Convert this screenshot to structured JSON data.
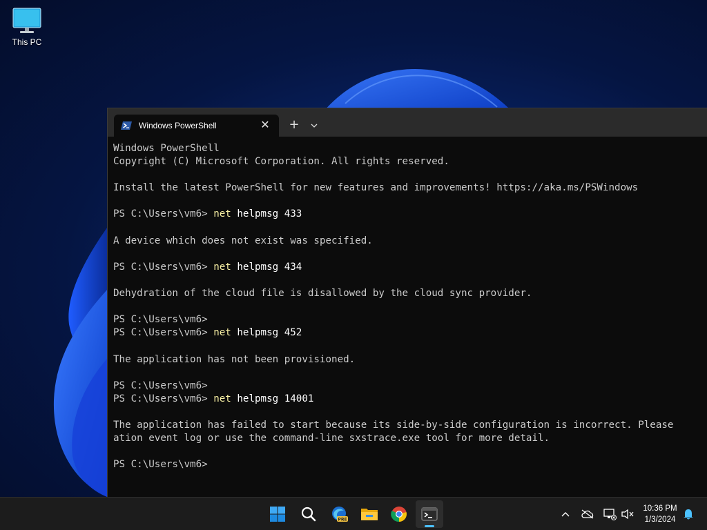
{
  "desktop": {
    "icons": [
      {
        "label": "This PC",
        "icon": "monitor-icon"
      }
    ]
  },
  "terminal": {
    "tab_title": "Windows PowerShell",
    "tab_close_glyph": "✕",
    "new_tab_glyph": "+",
    "lines": [
      {
        "text": "Windows PowerShell"
      },
      {
        "text": "Copyright (C) Microsoft Corporation. All rights reserved."
      },
      {
        "text": ""
      },
      {
        "text": "Install the latest PowerShell for new features and improvements! https://aka.ms/PSWindows"
      },
      {
        "text": ""
      },
      {
        "prompt": "PS C:\\Users\\vm6> ",
        "cmd": "net",
        "args": " helpmsg 433"
      },
      {
        "text": ""
      },
      {
        "text": "A device which does not exist was specified."
      },
      {
        "text": ""
      },
      {
        "prompt": "PS C:\\Users\\vm6> ",
        "cmd": "net",
        "args": " helpmsg 434"
      },
      {
        "text": ""
      },
      {
        "text": "Dehydration of the cloud file is disallowed by the cloud sync provider."
      },
      {
        "text": ""
      },
      {
        "prompt": "PS C:\\Users\\vm6>"
      },
      {
        "prompt": "PS C:\\Users\\vm6> ",
        "cmd": "net",
        "args": " helpmsg 452"
      },
      {
        "text": ""
      },
      {
        "text": "The application has not been provisioned."
      },
      {
        "text": ""
      },
      {
        "prompt": "PS C:\\Users\\vm6>"
      },
      {
        "prompt": "PS C:\\Users\\vm6> ",
        "cmd": "net",
        "args": " helpmsg 14001"
      },
      {
        "text": ""
      },
      {
        "text": "The application has failed to start because its side-by-side configuration is incorrect. Please"
      },
      {
        "text": "ation event log or use the command-line sxstrace.exe tool for more detail."
      },
      {
        "text": ""
      },
      {
        "prompt": "PS C:\\Users\\vm6>"
      }
    ]
  },
  "taskbar": {
    "apps": [
      {
        "name": "start-button",
        "icon": "windows-logo-icon"
      },
      {
        "name": "search-button",
        "icon": "search-icon"
      },
      {
        "name": "edge-button",
        "icon": "edge-dev-icon"
      },
      {
        "name": "file-explorer-button",
        "icon": "folder-icon"
      },
      {
        "name": "chrome-button",
        "icon": "chrome-icon"
      },
      {
        "name": "terminal-button",
        "icon": "terminal-icon",
        "active": true
      }
    ],
    "tray": [
      "chevron-up-icon",
      "cloud-off-icon",
      "network-icon",
      "volume-muted-icon"
    ],
    "clock": {
      "time": "10:36 PM",
      "date": "1/3/2024"
    },
    "notification_icon": "bell-icon"
  },
  "colors": {
    "console_bg": "#0c0c0c",
    "console_fg": "#cccccc",
    "command": "#f9f1a5",
    "accent": "#4cc2ff",
    "taskbar_bg": "#1c1c1c"
  }
}
